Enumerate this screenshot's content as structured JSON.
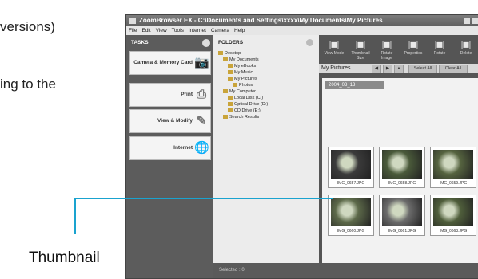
{
  "doc": {
    "line1": "versions)",
    "line2": "ing to the"
  },
  "callout": {
    "label": "Thumbnail",
    "color": "#1aa3cf"
  },
  "window": {
    "title": "ZoomBrowser EX - C:\\Documents and Settings\\xxxx\\My Documents\\My Pictures",
    "menu": [
      "File",
      "Edit",
      "View",
      "Tools",
      "Internet",
      "Camera",
      "Help"
    ]
  },
  "tasks": {
    "header": "TASKS",
    "buttons": [
      {
        "label": "Camera & Memory Card",
        "icon": "camera-icon",
        "glyph": "📷"
      },
      {
        "label": "Print",
        "icon": "printer-icon",
        "glyph": "⎙"
      },
      {
        "label": "View & Modify",
        "icon": "edit-image-icon",
        "glyph": "✎"
      },
      {
        "label": "Internet",
        "icon": "globe-icon",
        "glyph": "🌐"
      }
    ]
  },
  "folders": {
    "header": "FOLDERS",
    "items": [
      {
        "label": "Desktop",
        "indent": 0
      },
      {
        "label": "My Documents",
        "indent": 1
      },
      {
        "label": "My eBooks",
        "indent": 2
      },
      {
        "label": "My Music",
        "indent": 2
      },
      {
        "label": "My Pictures",
        "indent": 2
      },
      {
        "label": "Photos",
        "indent": 3
      },
      {
        "label": "My Computer",
        "indent": 1
      },
      {
        "label": "Local Disk (C:)",
        "indent": 2
      },
      {
        "label": "Optical Drive (D:)",
        "indent": 2
      },
      {
        "label": "CD Drive (E:)",
        "indent": 2
      },
      {
        "label": "Search Results",
        "indent": 1
      }
    ]
  },
  "browser": {
    "toolbar": [
      {
        "label": "View Mode",
        "icon": "view-mode-icon"
      },
      {
        "label": "Thumbnail Size",
        "icon": "thumbnail-size-icon"
      },
      {
        "label": "Rotate Image",
        "icon": "rotate-icon"
      },
      {
        "label": "Properties",
        "icon": "properties-icon"
      },
      {
        "label": "Rotate",
        "icon": "rotate-right-icon"
      },
      {
        "label": "Delete",
        "icon": "delete-icon"
      }
    ],
    "location": "My Pictures",
    "select_all": "Select All",
    "clear_all": "Clear All",
    "date_group": "2004_03_13",
    "thumbnails": [
      {
        "name": "IMG_0657.JPG",
        "color": "#3b3b3b"
      },
      {
        "name": "IMG_0658.JPG",
        "color": "#4a5a3a"
      },
      {
        "name": "IMG_0659.JPG",
        "color": "#55633f"
      },
      {
        "name": "IMG_0660.JPG",
        "color": "#5d6a4a"
      },
      {
        "name": "IMG_0661.JPG",
        "color": "#6b6b6b"
      },
      {
        "name": "IMG_0663.JPG",
        "color": "#4f5e3b"
      }
    ]
  },
  "status": {
    "selected": "Selected : 0"
  }
}
